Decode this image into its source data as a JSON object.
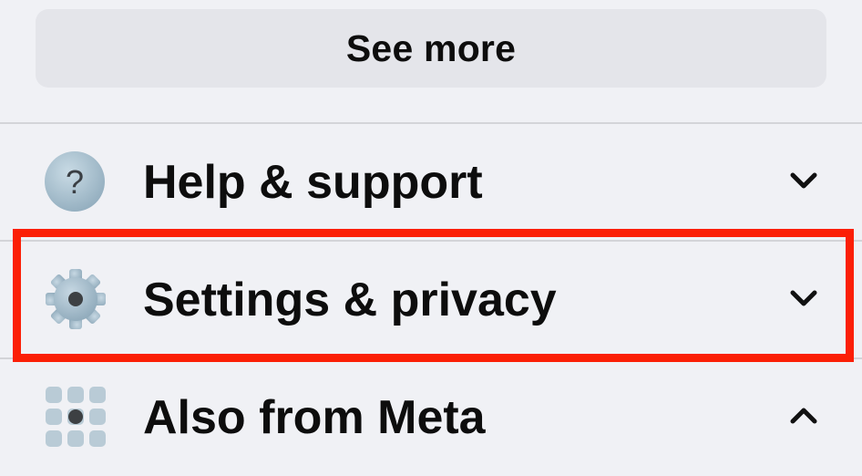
{
  "see_more": {
    "label": "See more"
  },
  "menu": {
    "items": [
      {
        "label": "Help & support",
        "icon": "help-circle-icon",
        "chevron": "chevron-down-icon",
        "expanded": false
      },
      {
        "label": "Settings & privacy",
        "icon": "gear-icon",
        "chevron": "chevron-down-icon",
        "expanded": false,
        "highlighted": true
      },
      {
        "label": "Also from Meta",
        "icon": "apps-grid-icon",
        "chevron": "chevron-up-icon",
        "expanded": true
      }
    ]
  },
  "colors": {
    "background": "#f0f1f5",
    "button_background": "#e4e5ea",
    "divider": "#d3d4d8",
    "highlight": "#fb1f06",
    "text": "#0d0d0d",
    "icon": "#a9c1cf"
  }
}
